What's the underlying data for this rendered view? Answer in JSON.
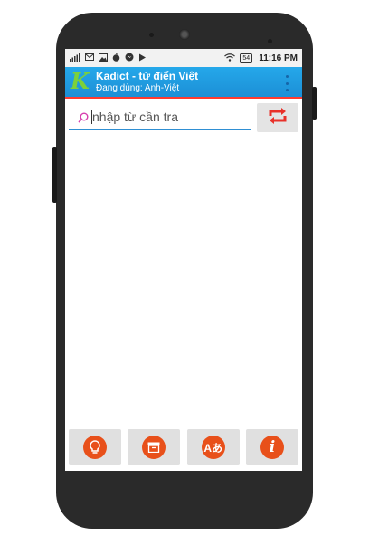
{
  "status_bar": {
    "left_icons": [
      "signal-icon",
      "mail-icon",
      "image-icon",
      "apple-icon",
      "messenger-icon",
      "play-icon"
    ],
    "battery": "54",
    "time": "11:16 PM"
  },
  "app_bar": {
    "title": "Kadict - từ điển Việt",
    "subtitle": "Đang dùng: Anh-Việt",
    "logo": "K",
    "accent_color": "#1c8fd6",
    "underline_color": "#ff3b30"
  },
  "search": {
    "placeholder": "nhập từ cần tra",
    "value": ""
  },
  "toolbar": {
    "buttons": [
      {
        "name": "idea-button",
        "icon": "lightbulb-icon"
      },
      {
        "name": "archive-button",
        "icon": "archive-box-icon"
      },
      {
        "name": "translate-button",
        "icon": "translate-icon",
        "label": "Aあ"
      },
      {
        "name": "info-button",
        "icon": "info-icon",
        "label": "i"
      }
    ],
    "button_color": "#e8501a"
  }
}
